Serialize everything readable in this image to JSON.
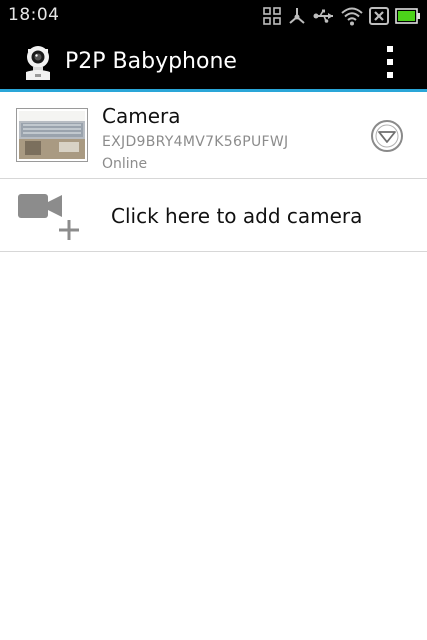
{
  "status_bar": {
    "time": "18:04",
    "icons": [
      "apps-grid-icon",
      "usb-debug-icon",
      "usb-icon",
      "wifi-icon",
      "no-sim-icon",
      "battery-icon"
    ],
    "battery_color": "#4cd21a"
  },
  "action_bar": {
    "title": "P2P Babyphone",
    "accent_color": "#2aa6d8",
    "icons": [
      "app-camera-logo-icon",
      "overflow-menu-icon"
    ]
  },
  "camera_list": {
    "items": [
      {
        "name": "Camera",
        "uid": "EXJD9BRY4MV7K56PUFWJ",
        "status": "Online",
        "icons": [
          "camera-thumbnail",
          "dropdown-circle-icon"
        ]
      }
    ],
    "add_camera": {
      "label": "Click here to add camera",
      "icon": "add-video-camera-icon"
    }
  }
}
